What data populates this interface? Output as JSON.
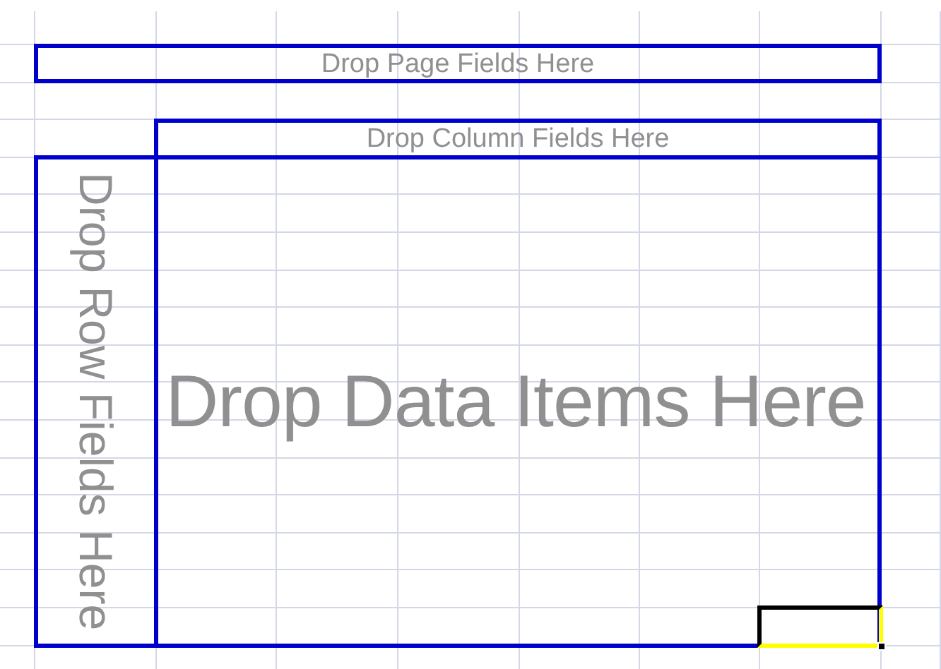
{
  "pivot_table": {
    "page_fields": {
      "label": "Drop Page Fields Here"
    },
    "column_fields": {
      "label": "Drop Column Fields Here"
    },
    "row_fields": {
      "label": "Drop Row Fields Here"
    },
    "data_area": {
      "label": "Drop Data Items Here"
    }
  }
}
